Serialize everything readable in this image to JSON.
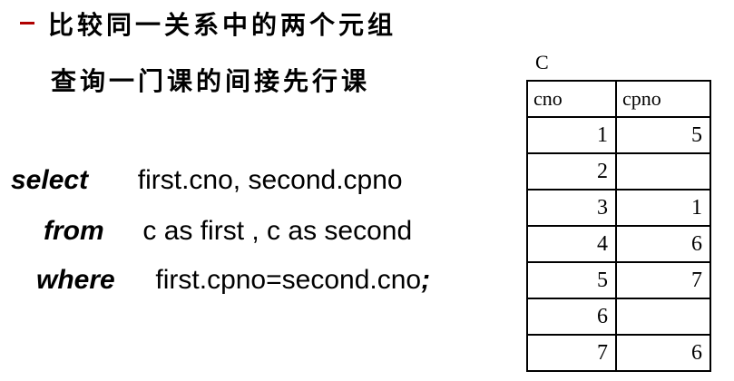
{
  "heading": "比较同一关系中的两个元组",
  "subheading": "查询一门课的间接先行课",
  "sql": {
    "select_kw": "select",
    "select_rest": "first.cno, second.cpno",
    "from_kw": "from",
    "from_rest": "c as first , c as second",
    "where_kw": "where",
    "where_rest": "first.cpno=second.cno",
    "terminator": ";"
  },
  "table": {
    "name": "C",
    "columns": [
      "cno",
      "cpno"
    ],
    "rows": [
      [
        "1",
        "5"
      ],
      [
        "2",
        ""
      ],
      [
        "3",
        "1"
      ],
      [
        "4",
        "6"
      ],
      [
        "5",
        "7"
      ],
      [
        "6",
        ""
      ],
      [
        "7",
        "6"
      ]
    ]
  },
  "colors": {
    "bullet": "#b00000"
  }
}
